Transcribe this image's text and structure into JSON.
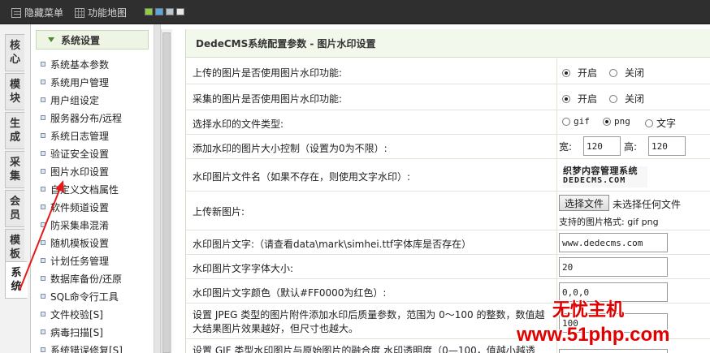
{
  "topbar": {
    "hide_menu": "隐藏菜单",
    "func_map": "功能地图",
    "swatches": [
      "#8fce3c",
      "#5aa7e0",
      "#b8c6d4",
      "#e8e8e8"
    ]
  },
  "tabs": [
    {
      "label": "核心",
      "icon": "tab-core"
    },
    {
      "label": "模块",
      "icon": "tab-module"
    },
    {
      "label": "生成",
      "icon": "tab-generate"
    },
    {
      "label": "采集",
      "icon": "tab-collect"
    },
    {
      "label": "会员",
      "icon": "tab-member"
    },
    {
      "label": "模板",
      "icon": "tab-template"
    },
    {
      "label": "系统",
      "icon": "tab-system",
      "active": true
    }
  ],
  "menu": {
    "title": "系统设置",
    "items": [
      "系统基本参数",
      "系统用户管理",
      "用户组设定",
      "服务器分布/远程",
      "系统日志管理",
      "验证安全设置",
      "图片水印设置",
      "自定义文档属性",
      "软件频道设置",
      "防采集串混淆",
      "随机模板设置",
      "计划任务管理",
      "数据库备份/还原",
      "SQL命令行工具",
      "文件校验[S]",
      "病毒扫描[S]",
      "系统错误修复[S]"
    ]
  },
  "main": {
    "title": "DedeCMS系统配置参数 - 图片水印设置",
    "rows": {
      "upload_watermark": {
        "label": "上传的图片是否使用图片水印功能:",
        "on": "开启",
        "off": "关闭",
        "selected": "on"
      },
      "collect_watermark": {
        "label": "采集的图片是否使用图片水印功能:",
        "on": "开启",
        "off": "关闭",
        "selected": "on"
      },
      "file_type": {
        "label": "选择水印的文件类型:",
        "options": [
          "gif",
          "png",
          "文字"
        ],
        "selected": "png"
      },
      "size_limit": {
        "label": "添加水印的图片大小控制（设置为0为不限）:",
        "width_label": "宽:",
        "width": "120",
        "height_label": "高:",
        "height": "120"
      },
      "image_name": {
        "label": "水印图片文件名（如果不存在，则使用文字水印）:",
        "logo_top": "织梦内容管理系统",
        "logo_bottom": "DEDECMS.COM"
      },
      "upload_new": {
        "label": "上传新图片:",
        "button": "选择文件",
        "no_file": "未选择任何文件",
        "formats": "支持的图片格式: gif png"
      },
      "text": {
        "label": "水印图片文字:（请查看data\\mark\\simhei.ttf字体库是否存在）",
        "value": "www.dedecms.com"
      },
      "font_size": {
        "label": "水印图片文字字体大小:",
        "value": "20"
      },
      "font_color": {
        "label": "水印图片文字颜色（默认#FF0000为红色）:",
        "value": "0,0,0"
      },
      "jpeg_quality": {
        "label_line1": "设置 JPEG 类型的图片附件添加水印后质量参数，范围为 0～100 的整数，数值越",
        "label_line2": "大结果图片效果越好，但尺寸也越大。",
        "value": "100"
      },
      "gif_alpha": {
        "label": "设置 GIF 类型水印图片与原始图片的融合度 水印透明度（0—100，值越小越透"
      }
    }
  },
  "watermark": {
    "line1": "无忧主机",
    "line2": "www.51php.com",
    "color": "#e00000"
  }
}
